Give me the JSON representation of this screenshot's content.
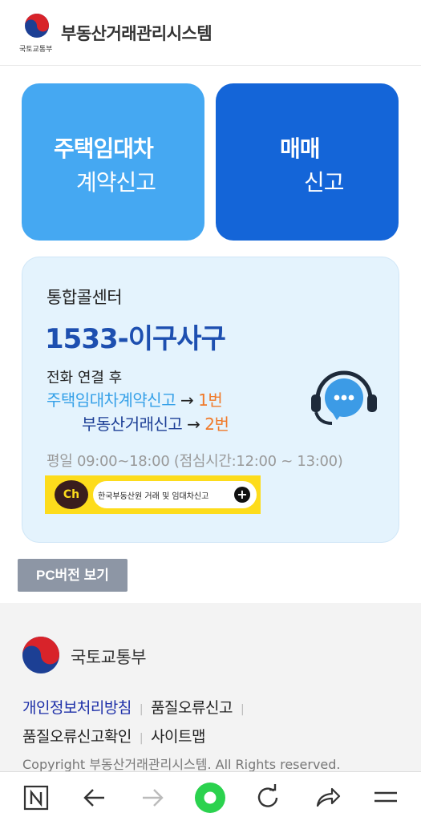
{
  "header": {
    "logo_text": "국토교통부",
    "site_title": "부동산거래관리시스템"
  },
  "cards": {
    "rent": {
      "title": "주택임대차",
      "sub": "계약신고"
    },
    "sale": {
      "title": "매매",
      "sub": "신고"
    }
  },
  "callcenter": {
    "title": "통합콜센터",
    "phone": "1533-이구사구",
    "connect": "전화 연결 후",
    "line1": {
      "label": "주택임대차계약신고",
      "arrow": "→",
      "number": "1번"
    },
    "line2": {
      "label": "부동산거래신고",
      "arrow": "→",
      "number": "2번"
    },
    "hours": "평일 09:00~18:00  (점심시간:12:00 ~ 13:00)",
    "kakao": {
      "badge": "Ch",
      "text": "한국부동산원 거래 및 임대차신고",
      "plus": "+"
    }
  },
  "pc_button": "PC버전 보기",
  "footer": {
    "ministry": "국토교통부",
    "links": [
      "개인정보처리방침",
      "품질오류신고",
      "품질오류신고확인",
      "사이트맵"
    ],
    "copyright": "Copyright 부동산거래관리시스템. All Rights reserved."
  },
  "browser_bar": {
    "icons": [
      "naver-n-icon",
      "back-arrow-icon",
      "forward-arrow-icon",
      "home-icon",
      "reload-icon",
      "share-icon",
      "menu-icon"
    ],
    "colors": {
      "home": "#2bd24e",
      "forward_disabled": "#bbbbbb"
    }
  },
  "colors": {
    "card_rent": "#45a8f2",
    "card_sale": "#1465d8",
    "callbox_bg": "#e4f3fd",
    "phone": "#1d4fb0",
    "orange": "#f07a2a",
    "kakao": "#fddc1c"
  }
}
